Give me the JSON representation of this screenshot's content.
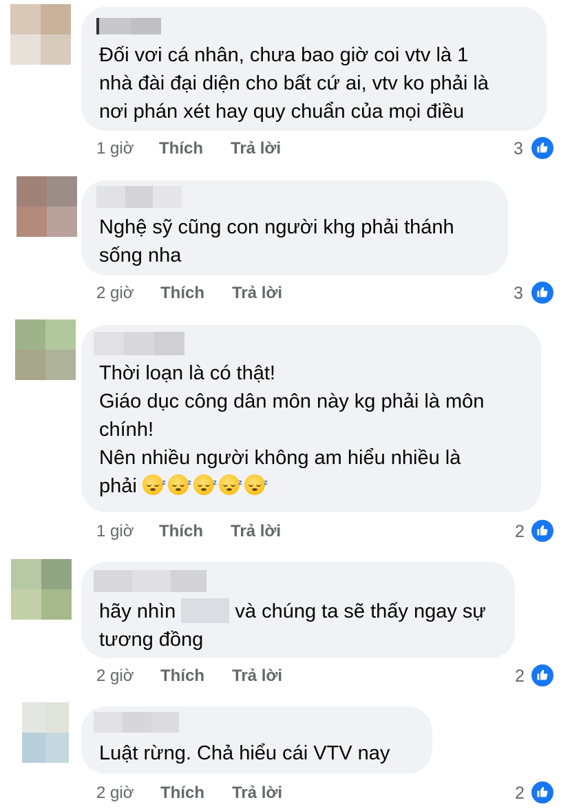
{
  "comments": [
    {
      "text": "Đối vơi cá nhân, chưa bao giờ coi vtv là 1\nnhà đài đại diện cho bất cứ ai, vtv ko phải là\nnơi phán xét hay quy chuẩn của mọi điều",
      "time": "1 giờ",
      "like_label": "Thích",
      "reply_label": "Trả lời",
      "likes": "3"
    },
    {
      "text": "Nghệ sỹ cũng con người khg phải thánh\nsống nha",
      "time": "2 giờ",
      "like_label": "Thích",
      "reply_label": "Trả lời",
      "likes": "3"
    },
    {
      "text": "Thời loạn là có thật!\nGiáo dục công dân môn này kg phải là môn\nchính!\nNên nhiều người không am hiểu nhiều là",
      "text_last": "phải ",
      "time": "1 giờ",
      "like_label": "Thích",
      "reply_label": "Trả lời",
      "likes": "2"
    },
    {
      "text_before": "hãy nhìn",
      "text_after": "và chúng ta sẽ thấy ngay sự\ntương đồng",
      "time": "2 giờ",
      "like_label": "Thích",
      "reply_label": "Trả lời",
      "likes": "2"
    },
    {
      "text": "Luật rừng. Chả hiểu cái VTV nay",
      "time": "2 giờ",
      "like_label": "Thích",
      "reply_label": "Trả lời",
      "likes": "2"
    }
  ],
  "colors": {
    "bubble": "#f0f2f5",
    "meta": "#65676b",
    "like_badge": "#1877f2"
  },
  "icons": {
    "like": "thumbs-up-icon",
    "emoji": "sleeping-face-emoji"
  }
}
